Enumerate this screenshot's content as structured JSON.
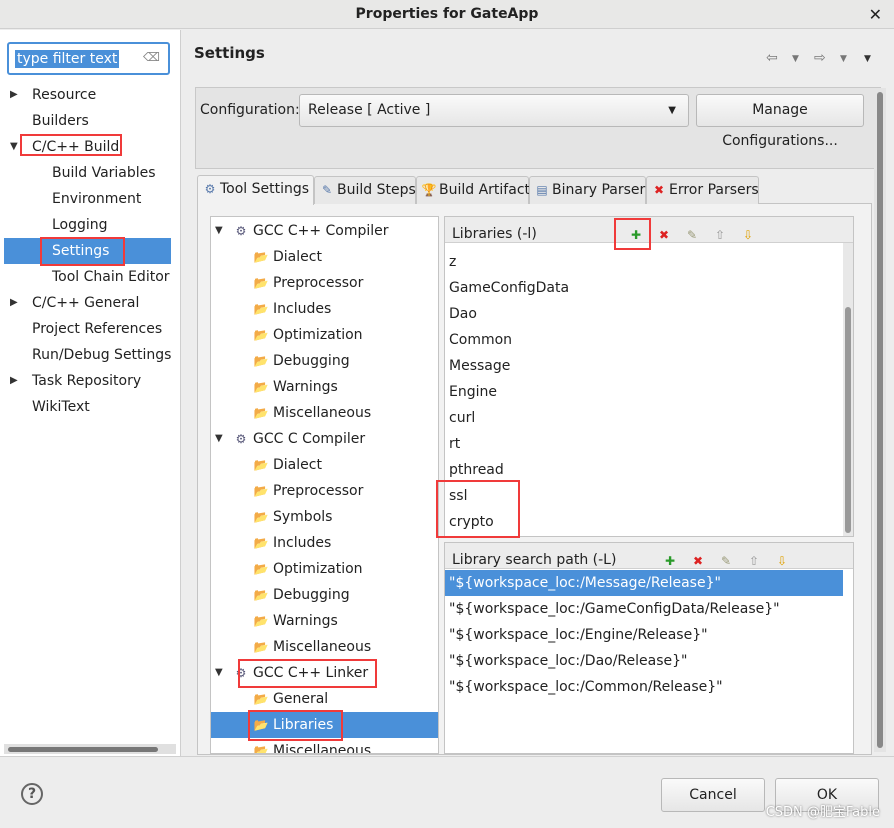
{
  "window": {
    "title": "Properties for GateApp",
    "close": "✕"
  },
  "filter": {
    "value": "type filter text"
  },
  "nav": [
    {
      "label": "Resource",
      "arrow": true,
      "indent": 0
    },
    {
      "label": "Builders",
      "indent": 0
    },
    {
      "label": "C/C++ Build",
      "arrow": "open",
      "indent": 0
    },
    {
      "label": "Build Variables",
      "indent": 1
    },
    {
      "label": "Environment",
      "indent": 1
    },
    {
      "label": "Logging",
      "indent": 1
    },
    {
      "label": "Settings",
      "indent": 1,
      "selected": true
    },
    {
      "label": "Tool Chain Editor",
      "indent": 1
    },
    {
      "label": "C/C++ General",
      "arrow": true,
      "indent": 0
    },
    {
      "label": "Project References",
      "indent": 0
    },
    {
      "label": "Run/Debug Settings",
      "indent": 0
    },
    {
      "label": "Task Repository",
      "arrow": true,
      "indent": 0
    },
    {
      "label": "WikiText",
      "indent": 0
    }
  ],
  "header": {
    "title": "Settings"
  },
  "config": {
    "label": "Configuration:",
    "value": "Release  [ Active ]",
    "manage": "Manage Configurations..."
  },
  "tabs": [
    {
      "label": "Tool Settings",
      "icon": "tool-settings-icon",
      "glyph": "⚙",
      "active": true
    },
    {
      "label": "Build Steps",
      "icon": "build-steps-icon",
      "glyph": "✎"
    },
    {
      "label": "Build Artifact",
      "icon": "trophy-icon",
      "glyph": "🏆"
    },
    {
      "label": "Binary Parsers",
      "icon": "binary-icon",
      "glyph": "▤"
    },
    {
      "label": "Error Parsers",
      "icon": "error-icon",
      "glyph": "✖"
    }
  ],
  "tool_tree": [
    {
      "label": "GCC C++ Compiler",
      "tool": true
    },
    {
      "label": "Dialect"
    },
    {
      "label": "Preprocessor"
    },
    {
      "label": "Includes"
    },
    {
      "label": "Optimization"
    },
    {
      "label": "Debugging"
    },
    {
      "label": "Warnings"
    },
    {
      "label": "Miscellaneous"
    },
    {
      "label": "GCC C Compiler",
      "tool": true
    },
    {
      "label": "Dialect"
    },
    {
      "label": "Preprocessor"
    },
    {
      "label": "Symbols"
    },
    {
      "label": "Includes"
    },
    {
      "label": "Optimization"
    },
    {
      "label": "Debugging"
    },
    {
      "label": "Warnings"
    },
    {
      "label": "Miscellaneous"
    },
    {
      "label": "GCC C++ Linker",
      "tool": true
    },
    {
      "label": "General"
    },
    {
      "label": "Libraries",
      "selected": true
    },
    {
      "label": "Miscellaneous"
    }
  ],
  "libraries": {
    "title": "Libraries (-l)",
    "items": [
      "z",
      "GameConfigData",
      "Dao",
      "Common",
      "Message",
      "Engine",
      "curl",
      "rt",
      "pthread",
      "ssl",
      "crypto"
    ]
  },
  "search_path": {
    "title": "Library search path (-L)",
    "items": [
      "\"${workspace_loc:/Message/Release}\"",
      "\"${workspace_loc:/GameConfigData/Release}\"",
      "\"${workspace_loc:/Engine/Release}\"",
      "\"${workspace_loc:/Dao/Release}\"",
      "\"${workspace_loc:/Common/Release}\""
    ]
  },
  "footer": {
    "cancel": "Cancel",
    "ok": "OK",
    "help": "?",
    "watermark": "CSDN @肥宝Fable"
  },
  "colors": {
    "selection": "#4a90d9",
    "highlight": "#f03a3a"
  }
}
